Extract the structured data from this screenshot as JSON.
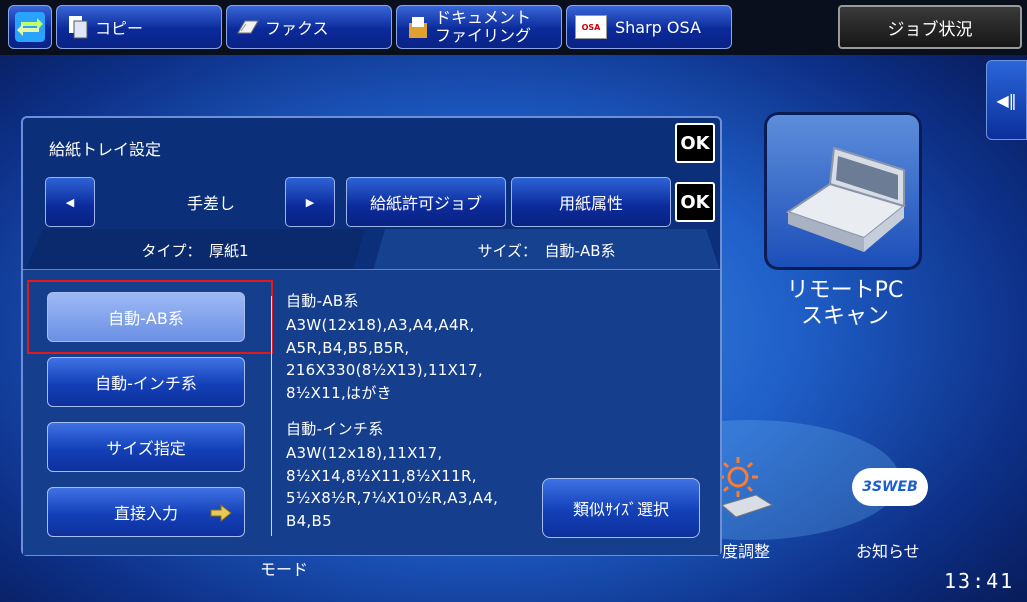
{
  "topbar": {
    "home_label": "",
    "copy_label": "コピー",
    "fax_label": "ファクス",
    "docfile_line1": "ドキュメント",
    "docfile_line2": "ファイリング",
    "osa_label": "Sharp OSA",
    "osa_icon_text": "OSA",
    "job_status_label": "ジョブ状況"
  },
  "background": {
    "remote_scan_line1": "リモートPC",
    "remote_scan_line2": "スキャン",
    "mode_label": "モード",
    "brightness_label": "度調整",
    "notice_label": "お知らせ",
    "web_icon_text": "3SWEB",
    "side_tab_icon": "◀‖",
    "clock": "13:41"
  },
  "dialog": {
    "title": "給紙トレイ設定",
    "ok_label": "OK",
    "tray_name": "手差し",
    "prev_icon": "◀",
    "next_icon": "▶",
    "allowed_jobs_label": "給紙許可ジョブ",
    "paper_attr_label": "用紙属性",
    "ok2_label": "OK",
    "tab_type": "タイプ：　厚紙1",
    "tab_size": "サイズ：　自動-AB系",
    "options": [
      "自動-AB系",
      "自動-インチ系",
      "サイズ指定",
      "直接入力"
    ],
    "ab_heading": "自動-AB系",
    "ab_sizes": "A3W(12x18),A3,A4,A4R,\nA5R,B4,B5,B5R,\n216X330(8½X13),11X17,\n8½X11,はがき",
    "inch_heading": "自動-インチ系",
    "inch_sizes": "A3W(12x18),11X17,\n8½X14,8½X11,8½X11R,\n5½X8½R,7¼X10½R,A3,A4,\nB4,B5",
    "similar_size_label": "類似ｻｲｽﾞ選択"
  }
}
